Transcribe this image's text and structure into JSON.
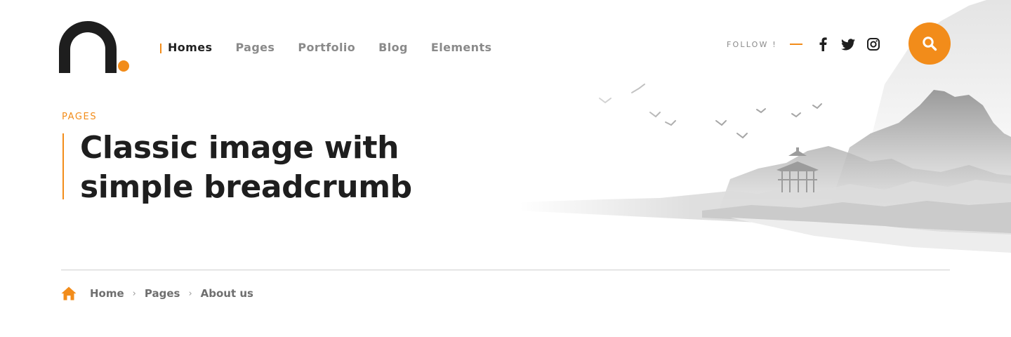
{
  "nav": {
    "items": [
      {
        "label": "Homes",
        "active": true
      },
      {
        "label": "Pages",
        "active": false
      },
      {
        "label": "Portfolio",
        "active": false
      },
      {
        "label": "Blog",
        "active": false
      },
      {
        "label": "Elements",
        "active": false
      }
    ]
  },
  "follow": {
    "label": "FOLLOW !",
    "icons": [
      "facebook-icon",
      "twitter-icon",
      "instagram-icon"
    ]
  },
  "search": {
    "icon": "search-icon"
  },
  "hero": {
    "eyebrow": "PAGES",
    "title_line1": "Classic image with",
    "title_line2": "simple breadcrumb"
  },
  "breadcrumb": {
    "home_icon": "home-icon",
    "items": [
      "Home",
      "Pages",
      "About us"
    ],
    "separator": "›"
  },
  "colors": {
    "accent": "#f28c1a",
    "text_dark": "#1e1e1e",
    "text_muted": "#8a8a8a",
    "divider": "#cfcfcf"
  }
}
